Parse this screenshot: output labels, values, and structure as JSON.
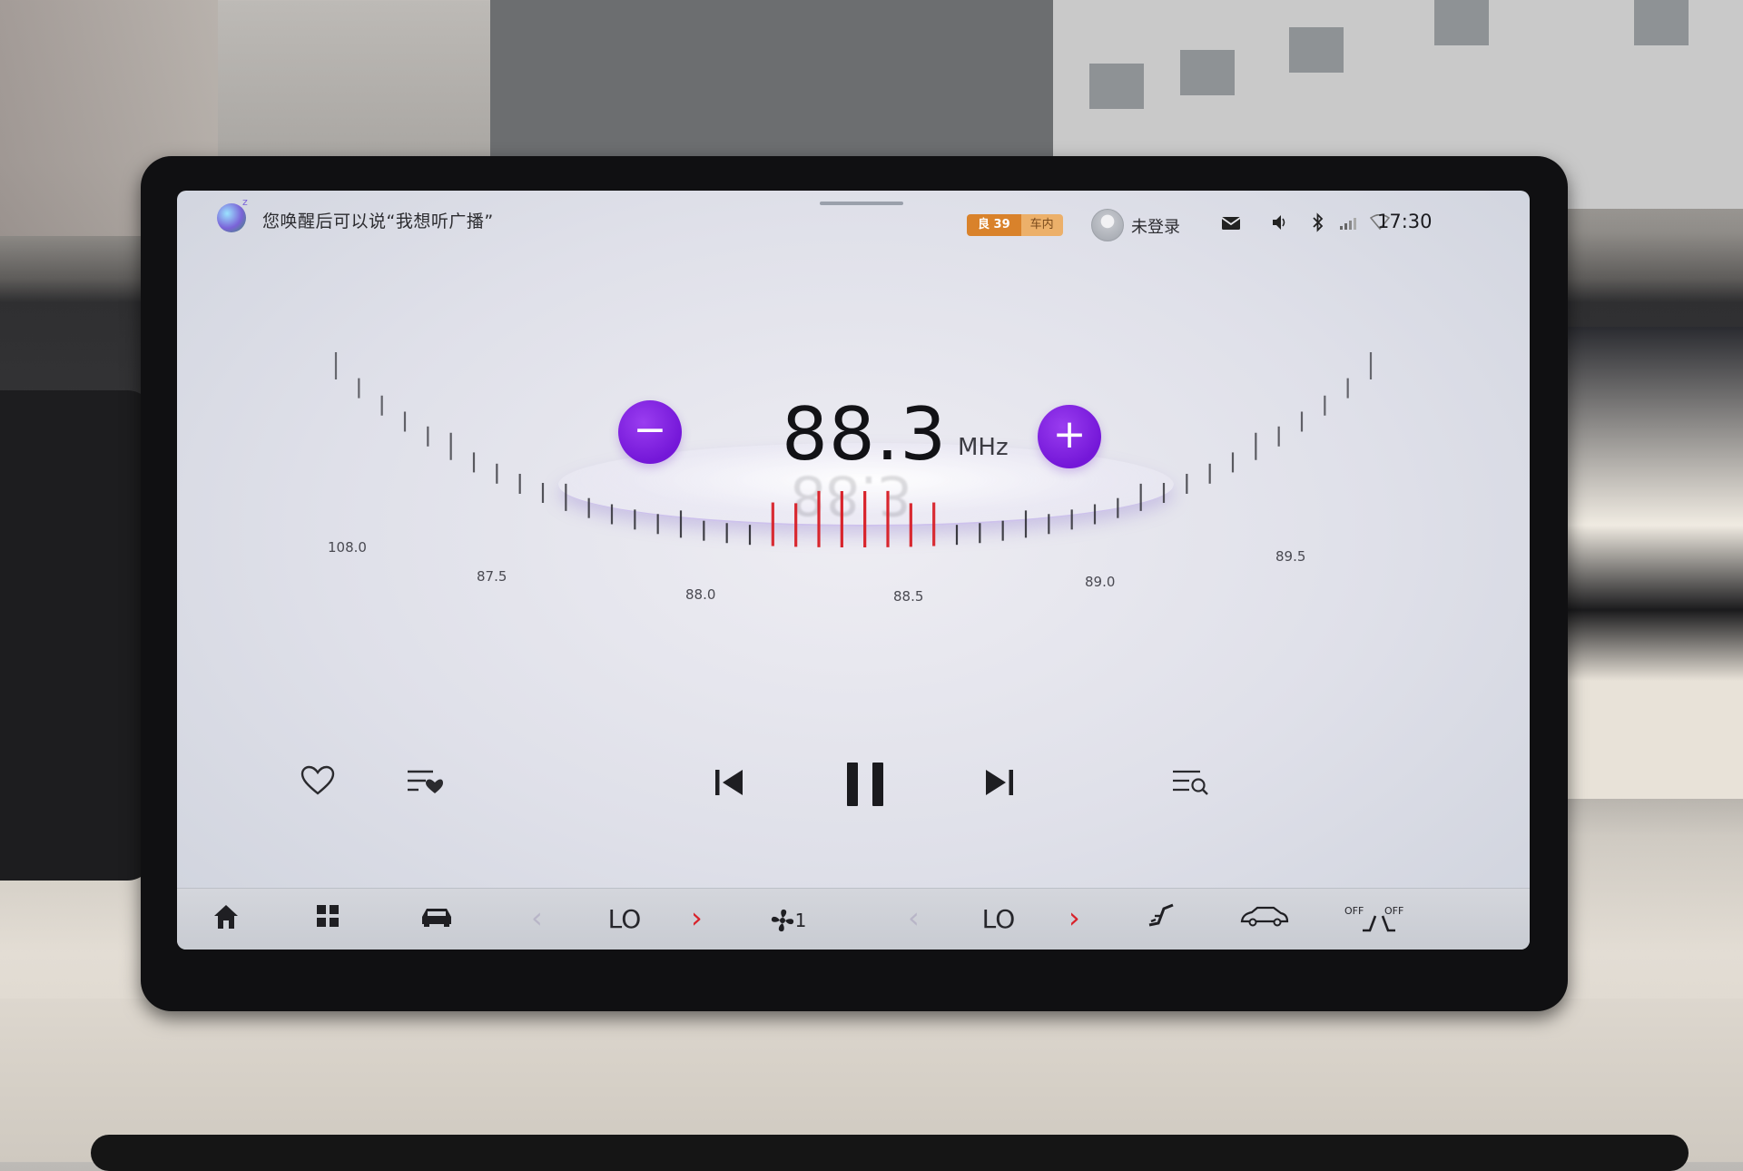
{
  "status_bar": {
    "voice_hint": "您唤醒后可以说“我想听广播”",
    "air_quality": {
      "label": "良 39",
      "location": "车内"
    },
    "user": "未登录",
    "time": "17:30",
    "icons": [
      "mail-icon",
      "speaker-icon",
      "bluetooth-icon",
      "signal-icon",
      "wifi-icon"
    ]
  },
  "radio": {
    "frequency": "88.3",
    "unit": "MHz",
    "dial_labels": [
      "108.0",
      "87.5",
      "88.0",
      "88.5",
      "89.0",
      "89.5"
    ],
    "accent": "#7417d8",
    "needle_color": "#d8222a"
  },
  "controls": [
    "favorite-icon",
    "favorite-list-icon",
    "previous-icon",
    "pause-icon",
    "next-icon",
    "search-list-icon"
  ],
  "bottom_bar": {
    "left_temp": "LO",
    "right_temp": "LO",
    "fan_level": "1",
    "seat_heat_left": "OFF",
    "seat_heat_right": "OFF",
    "arrow_colors": {
      "inactive": "#b8b5c7",
      "active": "#d8222a"
    }
  }
}
